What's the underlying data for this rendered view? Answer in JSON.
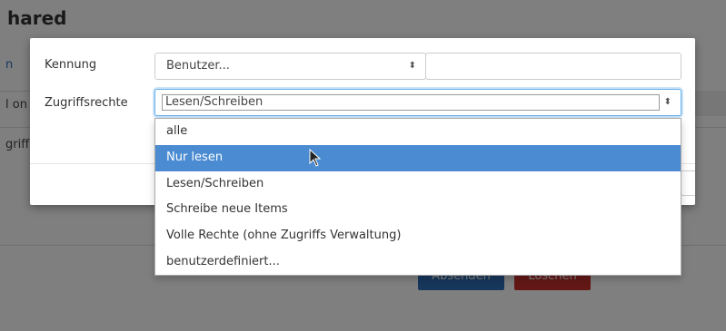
{
  "background": {
    "title": "hared",
    "link_fragment": "n",
    "row_fragment_1": "l on",
    "row_fragment_2": "griff",
    "submit_button": "Absenden",
    "delete_button": "Löschen"
  },
  "modal": {
    "identifier": {
      "label": "Kennung",
      "select_value": "Benutzer...",
      "text_value": ""
    },
    "access_rights": {
      "label": "Zugriffsrechte",
      "selected_value": "Lesen/Schreiben",
      "options": [
        "alle",
        "Nur lesen",
        "Lesen/Schreiben",
        "Schreibe neue Items",
        "Volle Rechte (ohne Zugriffs Verwaltung)",
        "benutzerdefiniert..."
      ],
      "highlighted_option": "Nur lesen"
    }
  },
  "icons": {
    "select_arrow": "updown-arrow-icon",
    "cursor": "mouse-pointer-icon"
  },
  "colors": {
    "highlight": "#4a8bd1",
    "focus_border": "#66afe9",
    "primary_button": "#2f6fb6",
    "danger_button": "#c9302c"
  }
}
